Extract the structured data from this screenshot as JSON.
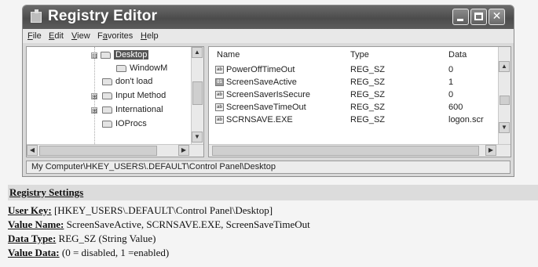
{
  "window": {
    "title": "Registry Editor",
    "minimize_label": "",
    "maximize_label": "",
    "close_label": "✕"
  },
  "menubar": {
    "items": [
      {
        "label": "File",
        "accesskey": "F"
      },
      {
        "label": "Edit",
        "accesskey": "E"
      },
      {
        "label": "View",
        "accesskey": "V"
      },
      {
        "label": "Favorites",
        "accesskey": "a"
      },
      {
        "label": "Help",
        "accesskey": "H"
      }
    ]
  },
  "tree": {
    "nodes": [
      {
        "label": "Desktop",
        "expander": "⊟",
        "selected": true
      },
      {
        "label": "WindowM",
        "expander": "",
        "selected": false
      },
      {
        "label": "don't load",
        "expander": "",
        "selected": false
      },
      {
        "label": "Input Method",
        "expander": "⊞",
        "selected": false
      },
      {
        "label": "International",
        "expander": "⊞",
        "selected": false
      },
      {
        "label": "IOProcs",
        "expander": "",
        "selected": false
      }
    ]
  },
  "values_list": {
    "columns": {
      "name": "Name",
      "type": "Type",
      "data": "Data"
    },
    "rows": [
      {
        "name": "PowerOffTimeOut",
        "type": "REG_SZ",
        "data": "0",
        "icon": "string-value-icon"
      },
      {
        "name": "ScreenSaveActive",
        "type": "REG_SZ",
        "data": "1",
        "icon": "binary-value-icon"
      },
      {
        "name": "ScreenSaverIsSecure",
        "type": "REG_SZ",
        "data": "0",
        "icon": "string-value-icon"
      },
      {
        "name": "ScreenSaveTimeOut",
        "type": "REG_SZ",
        "data": "600",
        "icon": "string-value-icon"
      },
      {
        "name": "SCRNSAVE.EXE",
        "type": "REG_SZ",
        "data": "logon.scr",
        "icon": "string-value-icon"
      }
    ]
  },
  "statusbar": {
    "path": "My Computer\\HKEY_USERS\\.DEFAULT\\Control Panel\\Desktop"
  },
  "settings": {
    "heading": "Registry Settings",
    "user_key_label": "User Key:",
    "user_key_value": "[HKEY_USERS\\.DEFAULT\\Control Panel\\Desktop]",
    "value_name_label": "Value Name:",
    "value_name_value": "ScreenSaveActive, SCRNSAVE.EXE, ScreenSaveTimeOut",
    "data_type_label": "Data Type:",
    "data_type_value": "REG_SZ (String Value)",
    "value_data_label": "Value Data:",
    "value_data_value": "(0 = disabled, 1 =enabled)"
  }
}
